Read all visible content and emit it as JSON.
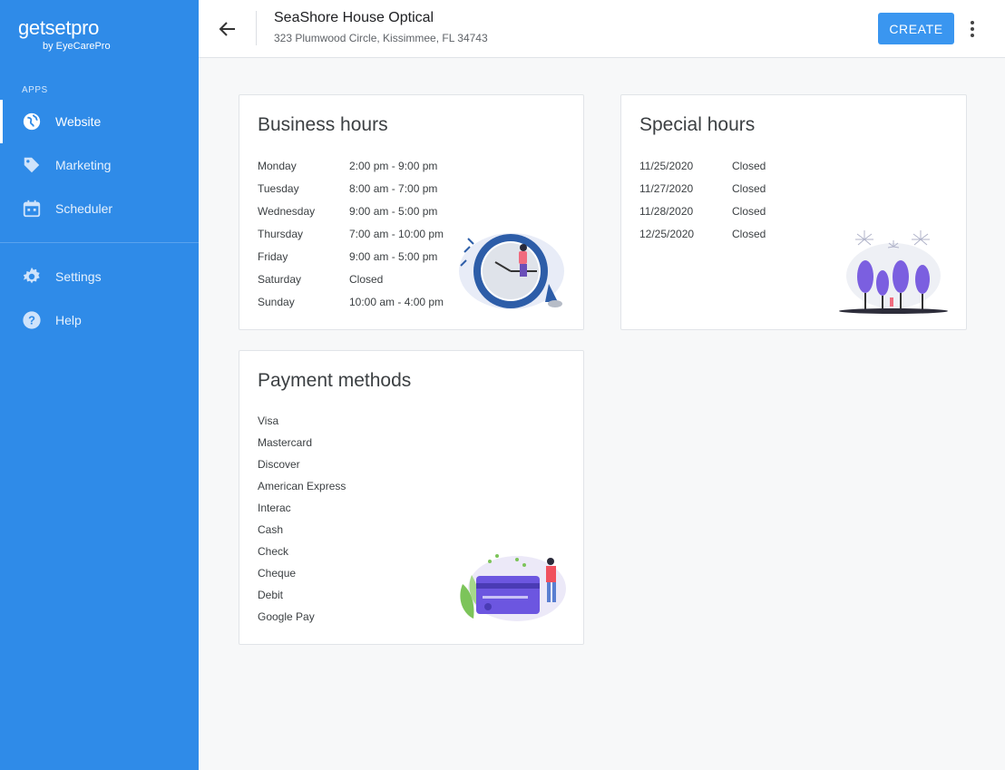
{
  "brand": {
    "name": "getsetpro",
    "tagline": "by EyeCarePro"
  },
  "sidebar": {
    "section_label": "APPS",
    "items": [
      {
        "label": "Website",
        "icon": "globe-icon",
        "active": true
      },
      {
        "label": "Marketing",
        "icon": "tag-icon",
        "active": false
      },
      {
        "label": "Scheduler",
        "icon": "calendar-icon",
        "active": false
      }
    ],
    "bottom_items": [
      {
        "label": "Settings",
        "icon": "gear-icon"
      },
      {
        "label": "Help",
        "icon": "help-icon"
      }
    ]
  },
  "header": {
    "title": "SeaShore House Optical",
    "address": "323 Plumwood Circle, Kissimmee, FL 34743",
    "create_label": "CREATE"
  },
  "business_hours": {
    "title": "Business hours",
    "rows": [
      {
        "day": "Monday",
        "hours": "2:00 pm - 9:00 pm"
      },
      {
        "day": "Tuesday",
        "hours": "8:00 am - 7:00 pm"
      },
      {
        "day": "Wednesday",
        "hours": "9:00 am - 5:00 pm"
      },
      {
        "day": "Thursday",
        "hours": "7:00 am - 10:00 pm"
      },
      {
        "day": "Friday",
        "hours": "9:00 am - 5:00 pm"
      },
      {
        "day": "Saturday",
        "hours": "Closed"
      },
      {
        "day": "Sunday",
        "hours": "10:00 am - 4:00 pm"
      }
    ]
  },
  "special_hours": {
    "title": "Special hours",
    "rows": [
      {
        "date": "11/25/2020",
        "status": "Closed"
      },
      {
        "date": "11/27/2020",
        "status": "Closed"
      },
      {
        "date": "11/28/2020",
        "status": "Closed"
      },
      {
        "date": "12/25/2020",
        "status": "Closed"
      }
    ]
  },
  "payment_methods": {
    "title": "Payment methods",
    "items": [
      "Visa",
      "Mastercard",
      "Discover",
      "American Express",
      "Interac",
      "Cash",
      "Check",
      "Cheque",
      "Debit",
      "Google Pay"
    ]
  },
  "colors": {
    "sidebar": "#2f8be8",
    "accent": "#3a96f0",
    "illustration_purple": "#7b5fe0"
  }
}
